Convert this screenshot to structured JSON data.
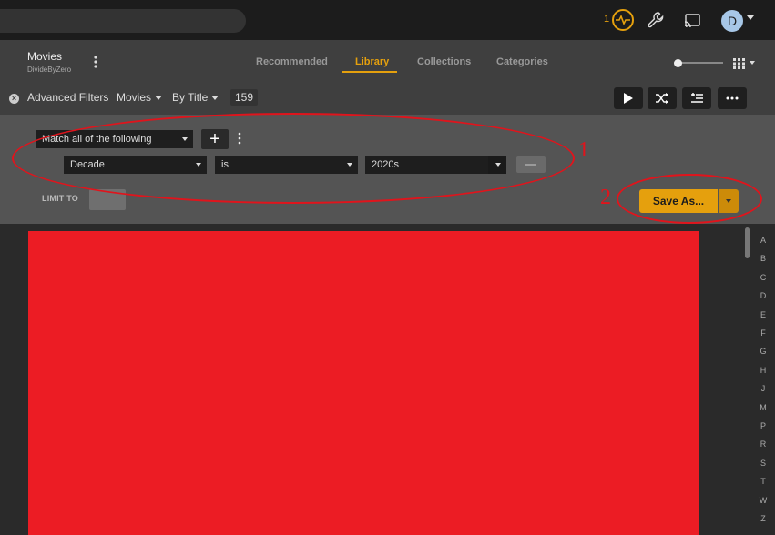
{
  "topbar": {
    "activity_count": "1",
    "avatar_letter": "D"
  },
  "library": {
    "title": "Movies",
    "server": "DivideByZero"
  },
  "tabs": [
    {
      "label": "Recommended"
    },
    {
      "label": "Library",
      "active": true
    },
    {
      "label": "Collections"
    },
    {
      "label": "Categories"
    }
  ],
  "filter_bar": {
    "advanced_filters_label": "Advanced Filters",
    "type_label": "Movies",
    "sort_label": "By Title",
    "count": "159"
  },
  "filter_panel": {
    "match_value": "Match all of the following",
    "rule": {
      "field": "Decade",
      "operator": "is",
      "value": "2020s"
    },
    "limit_label": "LIMIT TO",
    "save_as_label": "Save As..."
  },
  "annotations": {
    "label_1": "1",
    "label_2": "2",
    "color": "#e0141c"
  },
  "jump_letters": [
    "A",
    "B",
    "C",
    "D",
    "E",
    "F",
    "G",
    "H",
    "J",
    "M",
    "P",
    "R",
    "S",
    "T",
    "W",
    "Z"
  ],
  "colors": {
    "accent": "#e5a00d",
    "redaction": "#ec1c24"
  }
}
